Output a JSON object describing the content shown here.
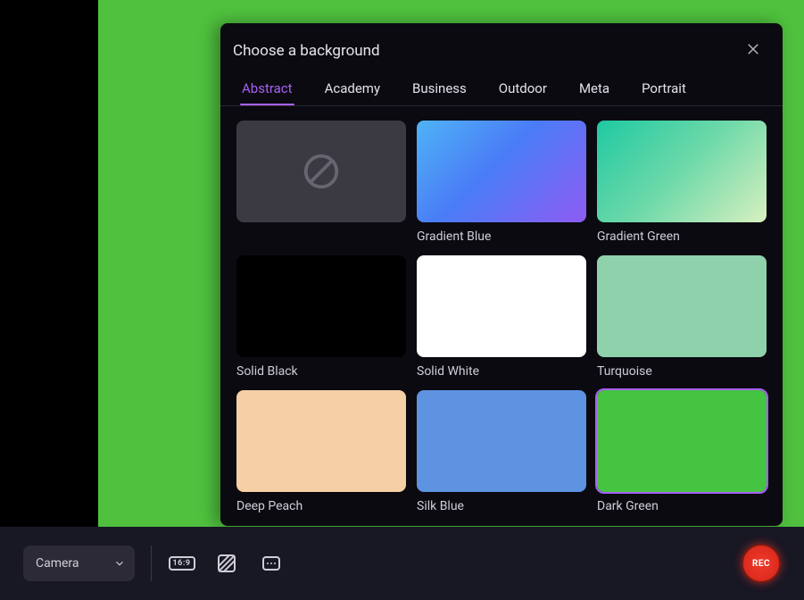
{
  "modal": {
    "title": "Choose a background",
    "tabs": [
      "Abstract",
      "Academy",
      "Business",
      "Outdoor",
      "Meta",
      "Portrait"
    ],
    "active_tab_index": 0,
    "items": [
      {
        "label": "",
        "style": "none",
        "selected": false
      },
      {
        "label": "Gradient Blue",
        "style": "grad-blue",
        "selected": false
      },
      {
        "label": "Gradient Green",
        "style": "grad-green",
        "selected": false
      },
      {
        "label": "Solid Black",
        "style": "black",
        "selected": false
      },
      {
        "label": "Solid White",
        "style": "white",
        "selected": false
      },
      {
        "label": "Turquoise",
        "style": "turquoise",
        "selected": false
      },
      {
        "label": "Deep Peach",
        "style": "peach",
        "selected": false
      },
      {
        "label": "Silk Blue",
        "style": "silkblue",
        "selected": false
      },
      {
        "label": "Dark Green",
        "style": "darkgreen",
        "selected": true
      }
    ]
  },
  "bottombar": {
    "camera_label": "Camera",
    "aspect_label": "16:9",
    "rec_label": "REC"
  }
}
